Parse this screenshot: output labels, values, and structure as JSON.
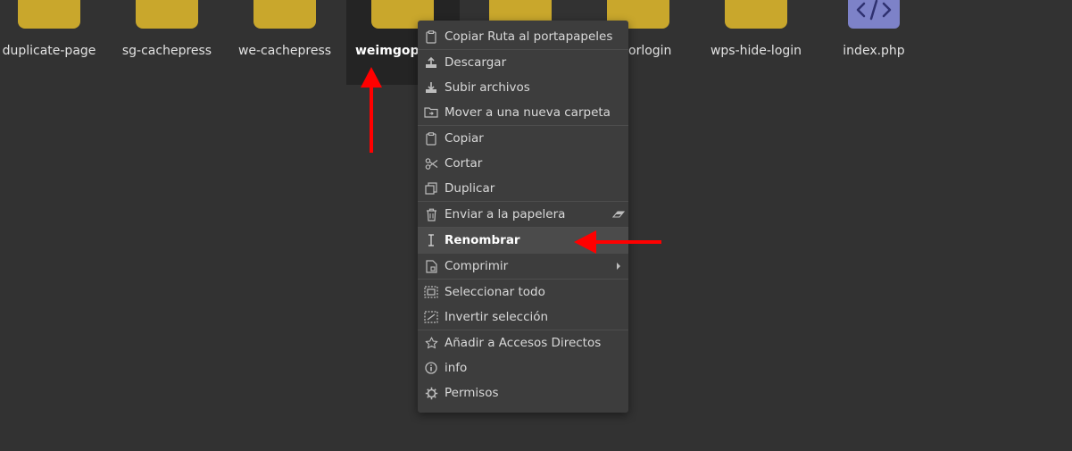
{
  "files": [
    {
      "name": "duplicate-page",
      "type": "folder"
    },
    {
      "name": "sg-cachepress",
      "type": "folder"
    },
    {
      "name": "we-cachepress",
      "type": "folder"
    },
    {
      "name": "weimgopti",
      "type": "folder"
    },
    {
      "name": "",
      "type": "folder"
    },
    {
      "name": "orlogin",
      "type": "folder"
    },
    {
      "name": "wps-hide-login",
      "type": "folder"
    },
    {
      "name": "index.php",
      "type": "file"
    }
  ],
  "context_menu": {
    "items": [
      {
        "label": "Copiar Ruta al portapapeles",
        "icon": "clipboard-path-icon"
      },
      {
        "label": "Descargar",
        "icon": "download-icon"
      },
      {
        "label": "Subir archivos",
        "icon": "upload-icon"
      },
      {
        "label": "Mover a una nueva carpeta",
        "icon": "move-to-folder-icon"
      },
      {
        "label": "Copiar",
        "icon": "copy-icon"
      },
      {
        "label": "Cortar",
        "icon": "cut-icon"
      },
      {
        "label": "Duplicar",
        "icon": "duplicate-icon"
      },
      {
        "label": "Enviar a la papelera",
        "icon": "trash-icon",
        "extra": "eraser-icon"
      },
      {
        "label": "Renombrar",
        "icon": "rename-icon",
        "active": true
      },
      {
        "label": "Comprimir",
        "icon": "compress-icon",
        "extra": "submenu-arrow-icon"
      },
      {
        "label": "Seleccionar todo",
        "icon": "select-all-icon"
      },
      {
        "label": "Invertir selección",
        "icon": "invert-selection-icon"
      },
      {
        "label": "Añadir a Accesos Directos",
        "icon": "star-icon"
      },
      {
        "label": "info",
        "icon": "info-icon"
      },
      {
        "label": "Permisos",
        "icon": "gear-icon"
      }
    ]
  },
  "colors": {
    "background": "#323232",
    "folder": "#c9a72c",
    "php_file": "#7d82c8",
    "menu_background": "#3d3d3d",
    "menu_active": "#4b4b4b",
    "annotation_arrow": "#ff0000"
  }
}
